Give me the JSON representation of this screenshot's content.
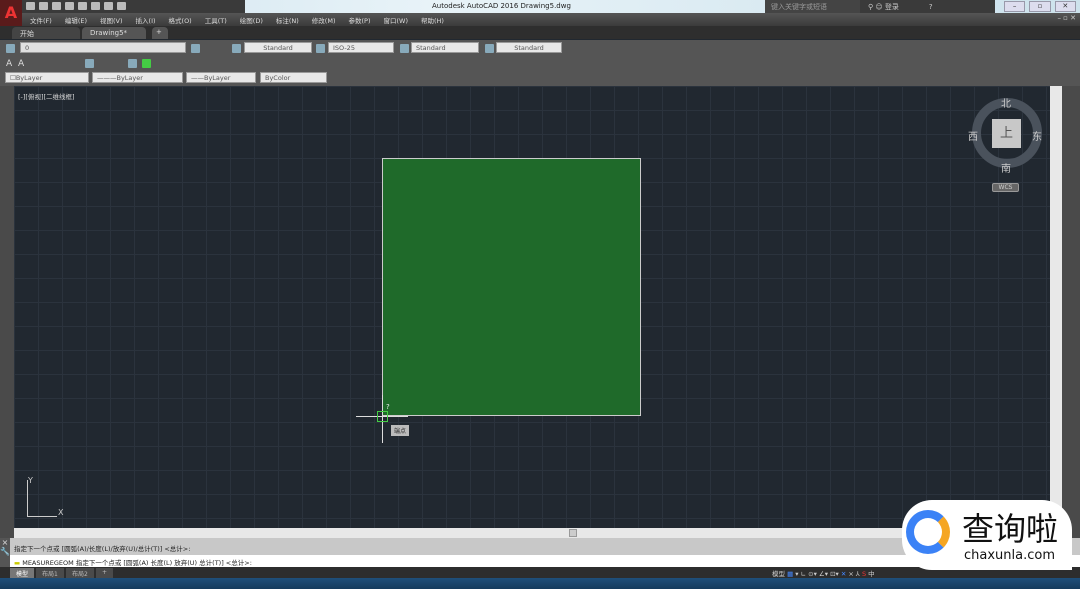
{
  "title": "Autodesk AutoCAD 2016    Drawing5.dwg",
  "search_placeholder": "键入关键字或短语",
  "login": "登录",
  "menu": [
    "文件(F)",
    "编辑(E)",
    "视图(V)",
    "插入(I)",
    "格式(O)",
    "工具(T)",
    "绘图(D)",
    "标注(N)",
    "修改(M)",
    "参数(P)",
    "窗口(W)",
    "帮助(H)"
  ],
  "tabs": [
    "开始",
    "Drawing5*",
    "+"
  ],
  "layer": "0",
  "styles": {
    "text": "Standard",
    "dim": "ISO-25",
    "table": "Standard",
    "mleader": "Standard"
  },
  "props": {
    "color": "ByLayer",
    "linetype": "ByLayer",
    "lineweight": "ByLayer",
    "plot": "ByColor"
  },
  "view_label": "[-][俯视][二维线框]",
  "compass": {
    "n": "北",
    "s": "南",
    "e": "东",
    "w": "西",
    "top": "上",
    "wcs": "WCS"
  },
  "tooltip": "端点",
  "cursor_mark": "?",
  "ucs": {
    "x": "X",
    "y": "Y"
  },
  "command_history": "指定下一个点或 [圆弧(A)/长度(L)/放弃(U)/总计(T)] <总计>:",
  "command_line": "MEASUREGEOM 指定下一个点或 [圆弧(A) 长度(L) 放弃(U) 总计(T)] <总计>:",
  "layout_tabs": [
    "模型",
    "布局1",
    "布局2",
    "+"
  ],
  "status": {
    "model": "模型",
    "ime": "中"
  },
  "watermark": {
    "cn": "查询啦",
    "url": "chaxunla.com"
  },
  "colors": {
    "fill": "#1f6a2a",
    "canvas": "#212830"
  }
}
